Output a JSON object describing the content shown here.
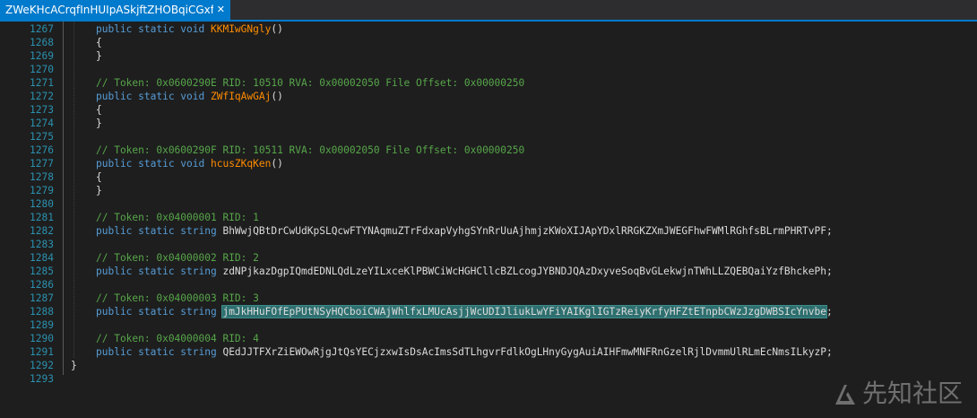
{
  "tab": {
    "title": "ZWeKHcACrqfInHUIpASkjftZHOBqiCGxf...",
    "close_glyph": "✕"
  },
  "watermark": {
    "text": "先知社区"
  },
  "colors": {
    "keyword": "#569cd6",
    "method": "#ff8c00",
    "comment": "#57a64a",
    "line_number": "#2b91af",
    "selection": "#2e6f6f"
  },
  "lines": [
    {
      "num": "1267",
      "indent": 2,
      "tokens": [
        {
          "t": "public static void ",
          "c": "kw"
        },
        {
          "t": "KKMIwGNgly",
          "c": "fn"
        },
        {
          "t": "()",
          "c": ""
        }
      ]
    },
    {
      "num": "1268",
      "indent": 2,
      "tokens": [
        {
          "t": "{",
          "c": ""
        }
      ]
    },
    {
      "num": "1269",
      "indent": 2,
      "tokens": [
        {
          "t": "}",
          "c": ""
        }
      ]
    },
    {
      "num": "1270",
      "indent": 0,
      "tokens": []
    },
    {
      "num": "1271",
      "indent": 2,
      "tokens": [
        {
          "t": "// Token: 0x0600290E RID: 10510 RVA: 0x00002050 File Offset: 0x00000250",
          "c": "cm"
        }
      ]
    },
    {
      "num": "1272",
      "indent": 2,
      "tokens": [
        {
          "t": "public static void ",
          "c": "kw"
        },
        {
          "t": "ZWfIqAwGAj",
          "c": "fn"
        },
        {
          "t": "()",
          "c": ""
        }
      ]
    },
    {
      "num": "1273",
      "indent": 2,
      "tokens": [
        {
          "t": "{",
          "c": ""
        }
      ]
    },
    {
      "num": "1274",
      "indent": 2,
      "tokens": [
        {
          "t": "}",
          "c": ""
        }
      ]
    },
    {
      "num": "1275",
      "indent": 0,
      "tokens": []
    },
    {
      "num": "1276",
      "indent": 2,
      "tokens": [
        {
          "t": "// Token: 0x0600290F RID: 10511 RVA: 0x00002050 File Offset: 0x00000250",
          "c": "cm"
        }
      ]
    },
    {
      "num": "1277",
      "indent": 2,
      "tokens": [
        {
          "t": "public static void ",
          "c": "kw"
        },
        {
          "t": "hcusZKqKen",
          "c": "fn"
        },
        {
          "t": "()",
          "c": ""
        }
      ]
    },
    {
      "num": "1278",
      "indent": 2,
      "tokens": [
        {
          "t": "{",
          "c": ""
        }
      ]
    },
    {
      "num": "1279",
      "indent": 2,
      "tokens": [
        {
          "t": "}",
          "c": ""
        }
      ]
    },
    {
      "num": "1280",
      "indent": 0,
      "tokens": []
    },
    {
      "num": "1281",
      "indent": 2,
      "tokens": [
        {
          "t": "// Token: 0x04000001 RID: 1",
          "c": "cm"
        }
      ]
    },
    {
      "num": "1282",
      "indent": 2,
      "tokens": [
        {
          "t": "public static string ",
          "c": "kw"
        },
        {
          "t": "BhWwjQBtDrCwUdKpSLQcwFTYNAqmuZTrFdxapVyhgSYnRrUuAjhmjzKWoXIJApYDxlRRGKZXmJWEGFhwFWMlRGhfsBLrmPHRTvPF",
          "c": ""
        },
        {
          "t": ";",
          "c": ""
        }
      ]
    },
    {
      "num": "1283",
      "indent": 0,
      "tokens": []
    },
    {
      "num": "1284",
      "indent": 2,
      "tokens": [
        {
          "t": "// Token: 0x04000002 RID: 2",
          "c": "cm"
        }
      ]
    },
    {
      "num": "1285",
      "indent": 2,
      "tokens": [
        {
          "t": "public static string ",
          "c": "kw"
        },
        {
          "t": "zdNPjkazDgpIQmdEDNLQdLzeYILxceKlPBWCiWcHGHCllcBZLcogJYBNDJQAzDxyveSoqBvGLekwjnTWhLLZQEBQaiYzfBhckePh",
          "c": ""
        },
        {
          "t": ";",
          "c": ""
        }
      ]
    },
    {
      "num": "1286",
      "indent": 0,
      "tokens": []
    },
    {
      "num": "1287",
      "indent": 2,
      "tokens": [
        {
          "t": "// Token: 0x04000003 RID: 3",
          "c": "cm"
        }
      ]
    },
    {
      "num": "1288",
      "indent": 2,
      "tokens": [
        {
          "t": "public static string ",
          "c": "kw"
        },
        {
          "t": "jmJkHHuFOfEpPUtNSyHQCboiCWAjWhlfxLMUcAsjjWcUDIJliukLwYFiYAIKglIGTzReiyKrfyHFZtETnpbCWzJzgDWBSIcYnvbe",
          "c": "sel"
        },
        {
          "t": ";",
          "c": ""
        }
      ]
    },
    {
      "num": "1289",
      "indent": 0,
      "tokens": []
    },
    {
      "num": "1290",
      "indent": 2,
      "tokens": [
        {
          "t": "// Token: 0x04000004 RID: 4",
          "c": "cm"
        }
      ]
    },
    {
      "num": "1291",
      "indent": 2,
      "tokens": [
        {
          "t": "public static string ",
          "c": "kw"
        },
        {
          "t": "QEdJJTFXrZiEWOwRjgJtQsYECjzxwIsDsAcImsSdTLhgvrFdlkOgLHnyGygAuiAIHFmwMNFRnGzelRjlDvmmUlRLmEcNmsILkyzP",
          "c": ""
        },
        {
          "t": ";",
          "c": ""
        }
      ]
    },
    {
      "num": "1292",
      "indent": 1,
      "tokens": [
        {
          "t": "}",
          "c": ""
        }
      ]
    },
    {
      "num": "1293",
      "indent": 0,
      "tokens": []
    }
  ]
}
